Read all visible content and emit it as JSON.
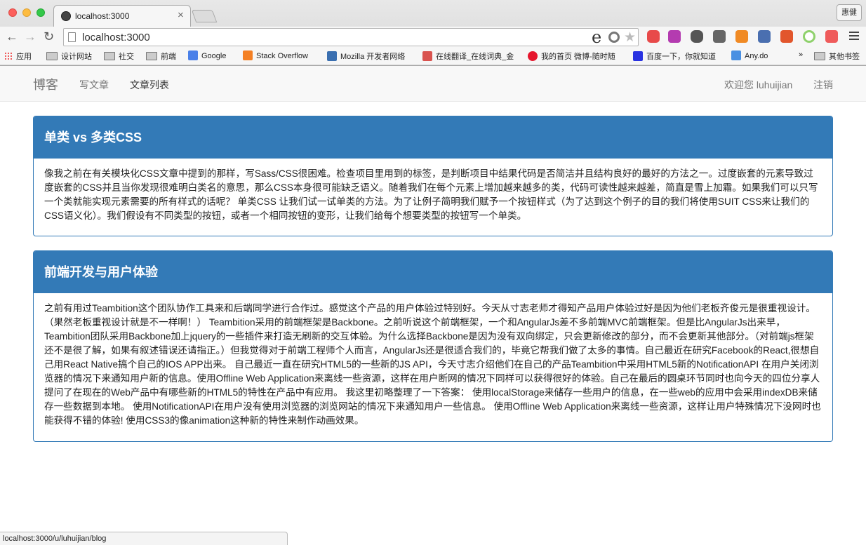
{
  "browser": {
    "tab_title": "localhost:3000",
    "tab_close": "×",
    "profile_label": "惠健",
    "address": "localhost:3000",
    "nav": {
      "back": "←",
      "forward": "→",
      "reload": "↻"
    },
    "omnibox_ie_glyph": "e",
    "omnibox_star": "★",
    "bookmarks": [
      {
        "label": "应用",
        "icon": "apps-grid-icon"
      },
      {
        "label": "设计网站",
        "icon": "folder-icon"
      },
      {
        "label": "社交",
        "icon": "folder-icon"
      },
      {
        "label": "前端",
        "icon": "folder-icon"
      },
      {
        "label": "Google",
        "icon": "google-icon"
      },
      {
        "label": "Stack Overflow",
        "icon": "stackoverflow-icon"
      },
      {
        "label": "Mozilla 开发者网络",
        "icon": "mozilla-icon"
      },
      {
        "label": "在线翻译_在线词典_金",
        "icon": "translate-icon"
      },
      {
        "label": "我的首页 微博-随时随",
        "icon": "weibo-icon"
      },
      {
        "label": "百度一下，你就知道",
        "icon": "baidu-icon"
      },
      {
        "label": "Any.do",
        "icon": "anydo-icon"
      },
      {
        "label": "»",
        "icon": ""
      },
      {
        "label": "其他书签",
        "icon": "folder-icon"
      }
    ]
  },
  "site": {
    "brand": "博客",
    "nav": [
      {
        "label": "写文章",
        "active": false
      },
      {
        "label": "文章列表",
        "active": true
      }
    ],
    "welcome": "欢迎您 luhuijian",
    "logout": "注销"
  },
  "articles": [
    {
      "title": "单类 vs 多类CSS",
      "body": "像我之前在有关模块化CSS文章中提到的那样，写Sass/CSS很困难。检查项目里用到的标签，是判断项目中结果代码是否简洁并且结构良好的最好的方法之一。过度嵌套的元素导致过度嵌套的CSS并且当你发现很难明白类名的意思，那么CSS本身很可能缺乏语义。随着我们在每个元素上增加越来越多的类，代码可读性越来越差，简直是雪上加霜。如果我们可以只写一个类就能实现元素需要的所有样式的话呢？ 单类CSS 让我们试一试单类的方法。为了让例子简明我们赋予一个按钮样式（为了达到这个例子的目的我们将使用SUIT CSS来让我们的CSS语义化）。我们假设有不同类型的按钮，或者一个相同按钮的变形，让我们给每个想要类型的按钮写一个单类。"
    },
    {
      "title": "前端开发与用户体验",
      "body": "之前有用过Teambition这个团队协作工具来和后端同学进行合作过。感觉这个产品的用户体验过特别好。今天从寸志老师才得知产品用户体验过好是因为他们老板齐俊元是很重视设计。（果然老板重视设计就是不一样啊！） Teambition采用的前端框架是Backbone。之前听说这个前端框架，一个和AngularJs差不多前端MVC前端框架。但是比AngularJs出来早，Teambition团队采用Backbone加上jquery的一些插件来打造无刷新的交互体验。为什么选择Backbone是因为没有双向绑定，只会更新修改的部分，而不会更新其他部分。（对前端js框架还不是很了解，如果有叙述错误还请指正。）但我觉得对于前端工程师个人而言，AngularJs还是很适合我们的，毕竟它帮我们做了太多的事情。自己最近在研究Facebook的React,很想自己用React Native搞个自己的IOS APP出来。 自己最近一直在研究HTML5的一些新的JS API，今天寸志介绍他们在自己的产品Teambition中采用HTML5新的NotificationAPI 在用户关闭浏览器的情况下来通知用户新的信息。使用Offline Web Application来离线一些资源，这样在用户断网的情况下同样可以获得很好的体验。自己在最后的圆桌环节同时也向今天的四位分享人提问了在现在的Web产品中有哪些新的HTML5的特性在产品中有应用。 我这里初略整理了一下答案： 使用localStorage来储存一些用户的信息，在一些web的应用中会采用indexDB来储存一些数据到本地。 使用NotificationAPI在用户没有使用浏览器的浏览网站的情况下来通知用户一些信息。 使用Offline Web Application来离线一些资源，这样让用户特殊情况下没网时也能获得不错的体验! 使用CSS3的像animation这种新的特性来制作动画效果。"
    }
  ],
  "status_url": "localhost:3000/u/luhuijian/blog",
  "colors": {
    "panel_primary": "#337ab7",
    "navbar_bg": "#f8f8f8"
  }
}
